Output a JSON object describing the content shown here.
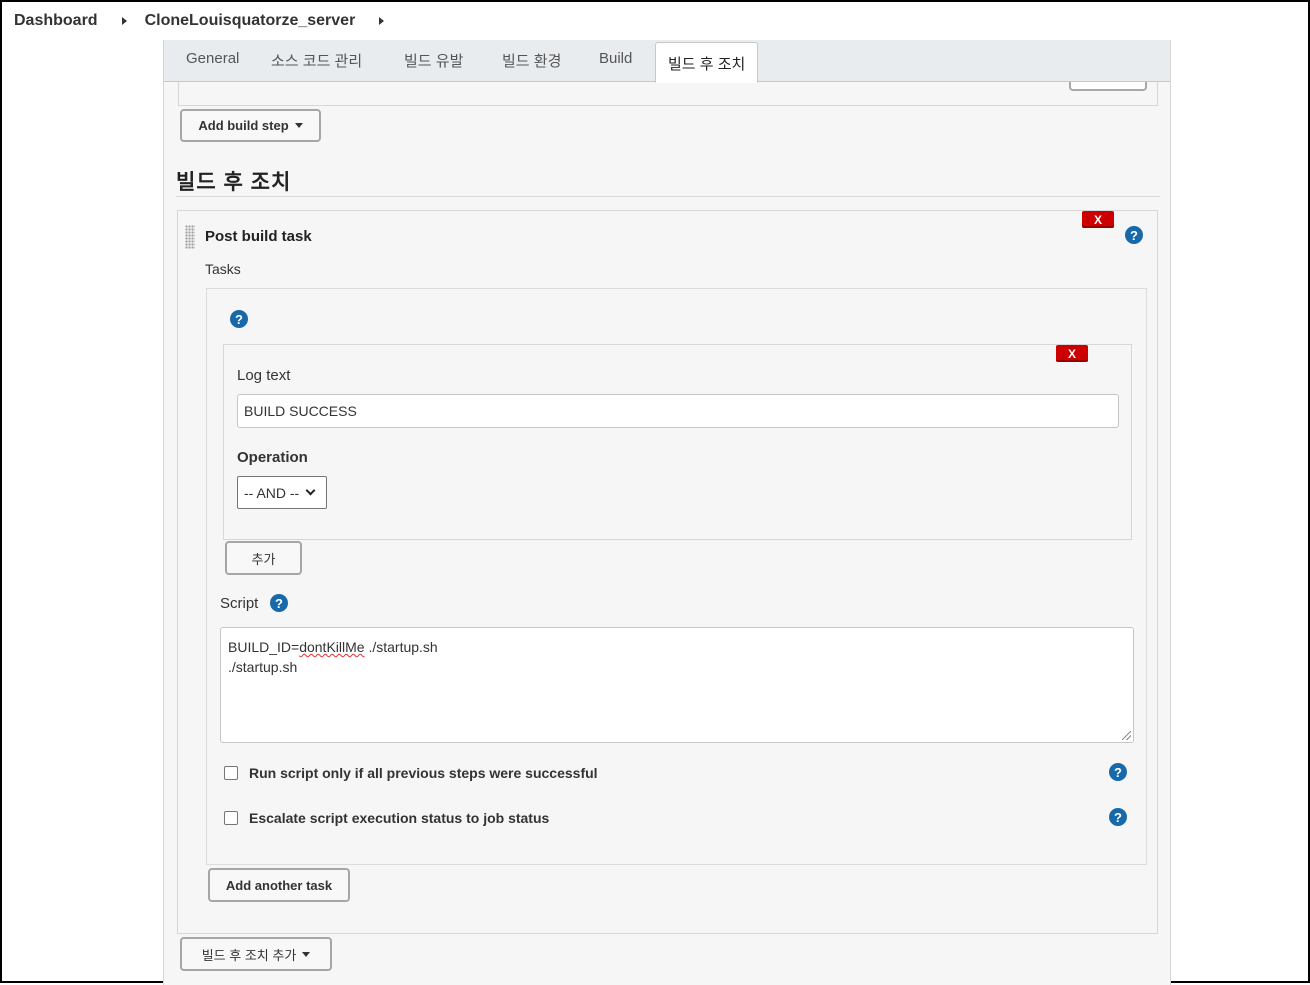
{
  "breadcrumb": {
    "items": [
      "Dashboard",
      "CloneLouisquatorze_server"
    ]
  },
  "tabs": [
    "General",
    "소스 코드 관리",
    "빌드 유발",
    "빌드 환경",
    "Build",
    "빌드 후 조치"
  ],
  "active_tab": "빌드 후 조치",
  "build": {
    "add_build_step_label": "Add build step"
  },
  "post_build": {
    "section_title": "빌드 후 조치",
    "task_title": "Post build task",
    "delete_label": "X",
    "tasks_label": "Tasks",
    "task": {
      "log_text_label": "Log text",
      "log_text_value": "BUILD SUCCESS",
      "operation_label": "Operation",
      "operation_value": "-- AND --"
    },
    "add_label": "추가",
    "script_label": "Script",
    "script_lines": {
      "line1_prefix": "BUILD_ID=",
      "line1_flagged": "dontKillMe",
      "line1_suffix": " ./startup.sh",
      "line2": "./startup.sh"
    },
    "checkbox_run_only_success": "Run script only if all previous steps were successful",
    "checkbox_escalate": "Escalate script execution status to job status",
    "add_another_task_label": "Add another task",
    "add_post_build_label": "빌드 후 조치 추가"
  },
  "help_symbol": "?",
  "colors": {
    "help_blue": "#1769aa",
    "delete_red": "#cc0000",
    "panel_bg": "#f6f6f6"
  }
}
